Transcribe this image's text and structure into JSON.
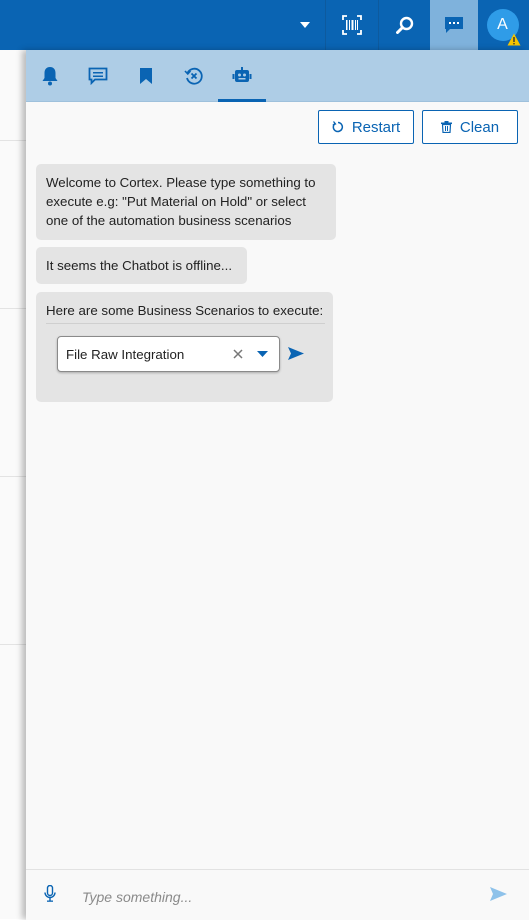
{
  "header": {
    "dropdown_icon": "caret-down-icon",
    "barcode_icon": "barcode-scan-icon",
    "search_icon": "search-icon",
    "chat_icon": "chat-icon",
    "avatar_initial": "A",
    "warning_icon": "warning-icon"
  },
  "tabs": [
    {
      "icon": "bell-icon",
      "active": false
    },
    {
      "icon": "message-icon",
      "active": false
    },
    {
      "icon": "bookmark-icon",
      "active": false
    },
    {
      "icon": "history-cancel-icon",
      "active": false
    },
    {
      "icon": "robot-icon",
      "active": true
    }
  ],
  "actions": {
    "restart_label": "Restart",
    "clean_label": "Clean"
  },
  "messages": {
    "welcome_lines": [
      "Welcome to Cortex. Please type something to",
      "execute e.g: \"Put Material on Hold\" or select",
      "one of the automation business scenarios"
    ],
    "offline": "It seems the Chatbot is offline...",
    "scenarios_title": "Here are some Business Scenarios to execute:",
    "scenario_selected": "File Raw Integration"
  },
  "input": {
    "placeholder": "Type something..."
  },
  "colors": {
    "primary": "#0a64b3",
    "tab_bar": "#aecde6",
    "bubble": "#e4e4e4",
    "warning": "#f5c400"
  }
}
